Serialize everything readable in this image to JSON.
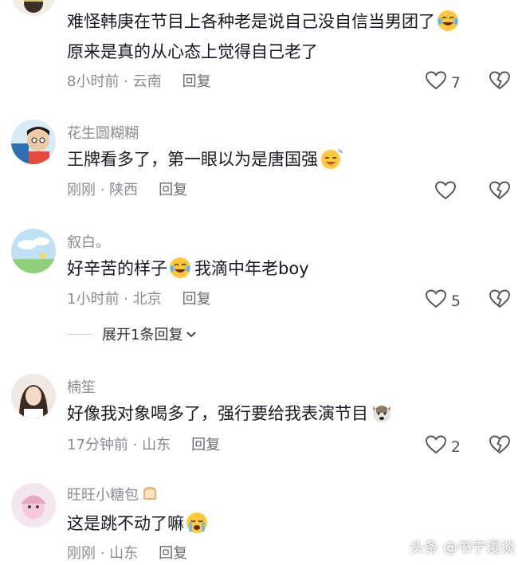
{
  "comments": [
    {
      "username": "",
      "lines": [
        "难怪韩庚在节目上各种老是说自己没自信当男团了",
        "原来是真的从心态上觉得自己老了"
      ],
      "emoji": "laughing-crying-emoji",
      "time": "8小时前 · 云南",
      "reply": "回复",
      "likes": "7"
    },
    {
      "username": "花生圆糊糊",
      "lines": [
        "王牌看多了，第一眼以为是唐国强"
      ],
      "emoji": "smirk-sweat-emoji",
      "time": "刚刚 · 陕西",
      "reply": "回复",
      "likes": ""
    },
    {
      "username": "叙白。",
      "lines": [
        "好辛苦的样子",
        "我滴中年老boy"
      ],
      "emoji": "laughing-crying-emoji",
      "time": "1小时前 · 北京",
      "reply": "回复",
      "likes": "5"
    },
    {
      "username": "楠笙",
      "lines": [
        "好像我对象喝多了，强行要给我表演节目"
      ],
      "emoji": "dog-face-emoji",
      "time": "17分钟前 · 山东",
      "reply": "回复",
      "likes": "2"
    },
    {
      "username": "旺旺小糖包",
      "lines": [
        "这是跳不动了嘛"
      ],
      "emoji": "crying-emoji",
      "time": "刚刚 · 山东",
      "reply": "回复",
      "likes": ""
    }
  ],
  "expand_replies": "展开1条回复",
  "watermark": "头条 @书宁漫谈",
  "colors": {
    "text": "#161823",
    "meta": "#8a8b91",
    "emoji_yellow": "#ffc83d"
  }
}
